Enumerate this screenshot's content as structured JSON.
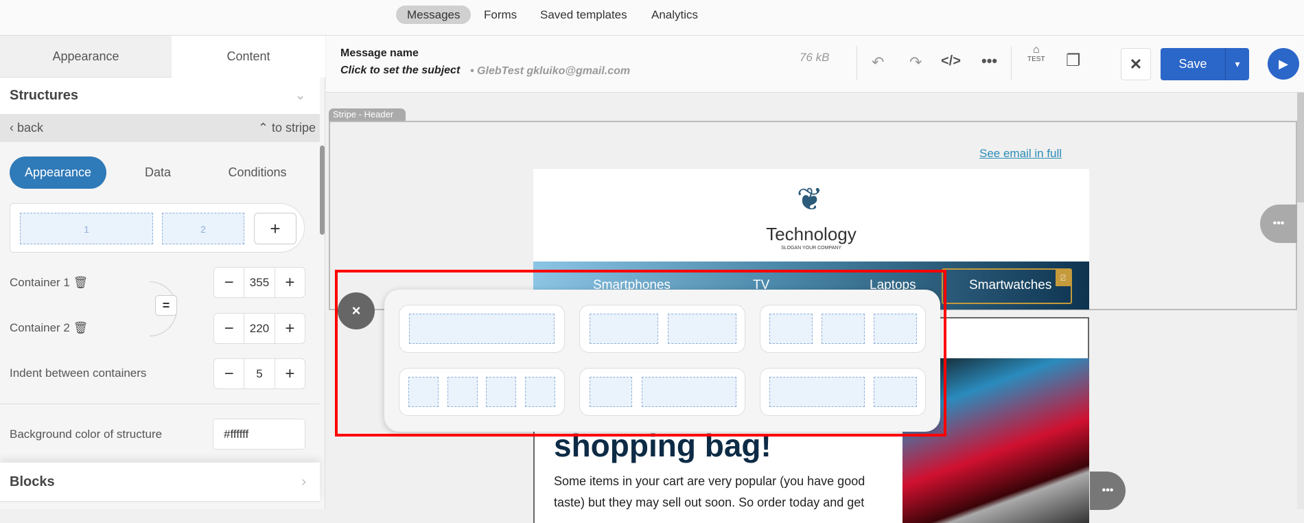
{
  "topnav": {
    "items": [
      {
        "label": "Messages",
        "active": true
      },
      {
        "label": "Forms"
      },
      {
        "label": "Saved templates"
      },
      {
        "label": "Analytics"
      }
    ]
  },
  "left": {
    "tabs": [
      "Appearance",
      "Content"
    ],
    "active_tab": "Content",
    "structures": "Structures",
    "back": "back",
    "to_stripe": "to stripe",
    "subtabs": [
      "Appearance",
      "Data",
      "Conditions"
    ],
    "active_subtab": "Appearance",
    "preview": [
      "1",
      "2"
    ],
    "container1": {
      "label": "Container 1",
      "value": "355"
    },
    "container2": {
      "label": "Container 2",
      "value": "220"
    },
    "indent": {
      "label": "Indent between containers",
      "value": "5"
    },
    "bg": {
      "label": "Background color of structure",
      "value": "#ffffff"
    },
    "blocks": "Blocks",
    "accent": "#2f7ab8"
  },
  "toolbar": {
    "message_name": "Message name",
    "subject": "Click to set the subject",
    "sender": "• GlebTest gkluiko@gmail.com",
    "size": "76 kB",
    "test": "TEST",
    "save": "Save",
    "save_color": "#2b66c9"
  },
  "canvas": {
    "stripe_label": "Stripe - Header",
    "see_full": "See email in full",
    "logo_name": "Technology",
    "logo_slogan": "SLOGAN YOUR COMPANY",
    "menu": [
      "Smartphones",
      "TV",
      "Laptops",
      "Smartwatches"
    ],
    "heading": "shopping bag!",
    "body": "Some items in your cart are very popular (you have good taste) but they may sell out soon. So order today and get"
  },
  "popup": {
    "layouts": [
      "1",
      "1:1",
      "1:1:1",
      "1:1:1:1",
      "1:2",
      "2:1"
    ]
  }
}
